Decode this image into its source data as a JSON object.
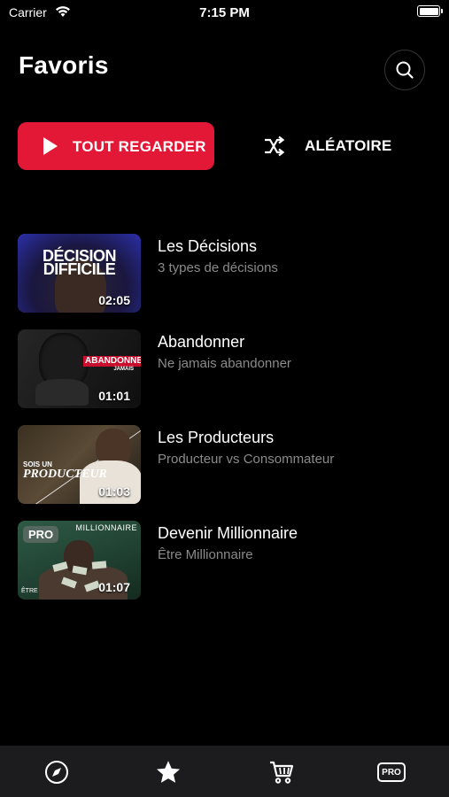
{
  "status_bar": {
    "carrier": "Carrier",
    "time": "7:15 PM"
  },
  "header": {
    "title": "Favoris"
  },
  "actions": {
    "play_all_label": "TOUT REGARDER",
    "shuffle_label": "ALÉATOIRE",
    "accent_color": "#e31837"
  },
  "videos": [
    {
      "title": "Les Décisions",
      "subtitle": "3 types de décisions",
      "duration": "02:05",
      "thumb_text": "DÉCISION DIFFICILE"
    },
    {
      "title": "Abandonner",
      "subtitle": "Ne jamais abandonner",
      "duration": "01:01",
      "thumb_text": "ABANDONNE",
      "thumb_text2": "JAMAIS"
    },
    {
      "title": "Les Producteurs",
      "subtitle": "Producteur vs Consommateur",
      "duration": "01:03",
      "thumb_text": "SOIS UN",
      "thumb_text2": "PRODUCTEUR"
    },
    {
      "title": "Devenir Millionnaire",
      "subtitle": "Être Millionnaire",
      "duration": "01:07",
      "thumb_text": "MILLIONNAIRE",
      "thumb_text2": "ÊTRE",
      "badge": "PRO"
    }
  ],
  "tabbar": {
    "items": [
      {
        "icon": "compass-icon"
      },
      {
        "icon": "star-icon",
        "active": true
      },
      {
        "icon": "cart-icon"
      },
      {
        "icon": "pro-icon",
        "label": "PRO"
      }
    ]
  }
}
